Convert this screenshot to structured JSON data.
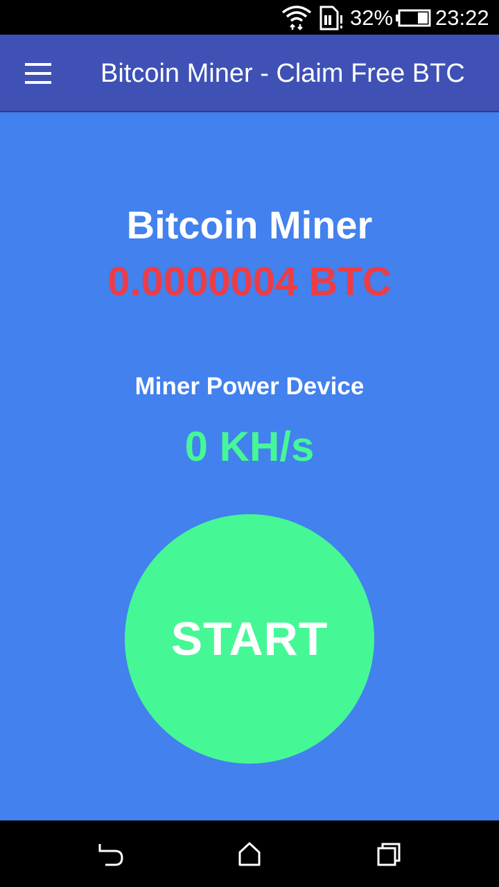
{
  "status_bar": {
    "battery_percent": "32%",
    "time": "23:22",
    "icons": [
      "wifi-icon",
      "sim-alert-icon",
      "battery-icon"
    ]
  },
  "app_bar": {
    "title": "Bitcoin Miner - Claim Free BTC",
    "menu_icon": "hamburger-menu-icon"
  },
  "main": {
    "heading": "Bitcoin Miner",
    "balance": "0.0000004 BTC",
    "power_label": "Miner Power Device",
    "power_value": "0 KH/s",
    "start_label": "START"
  },
  "nav_bar": {
    "icons": [
      "back-icon",
      "home-icon",
      "recent-apps-icon"
    ]
  },
  "colors": {
    "background": "#4281ee",
    "app_bar": "#3f51b5",
    "balance": "#ee3c45",
    "accent_green": "#45f895"
  }
}
